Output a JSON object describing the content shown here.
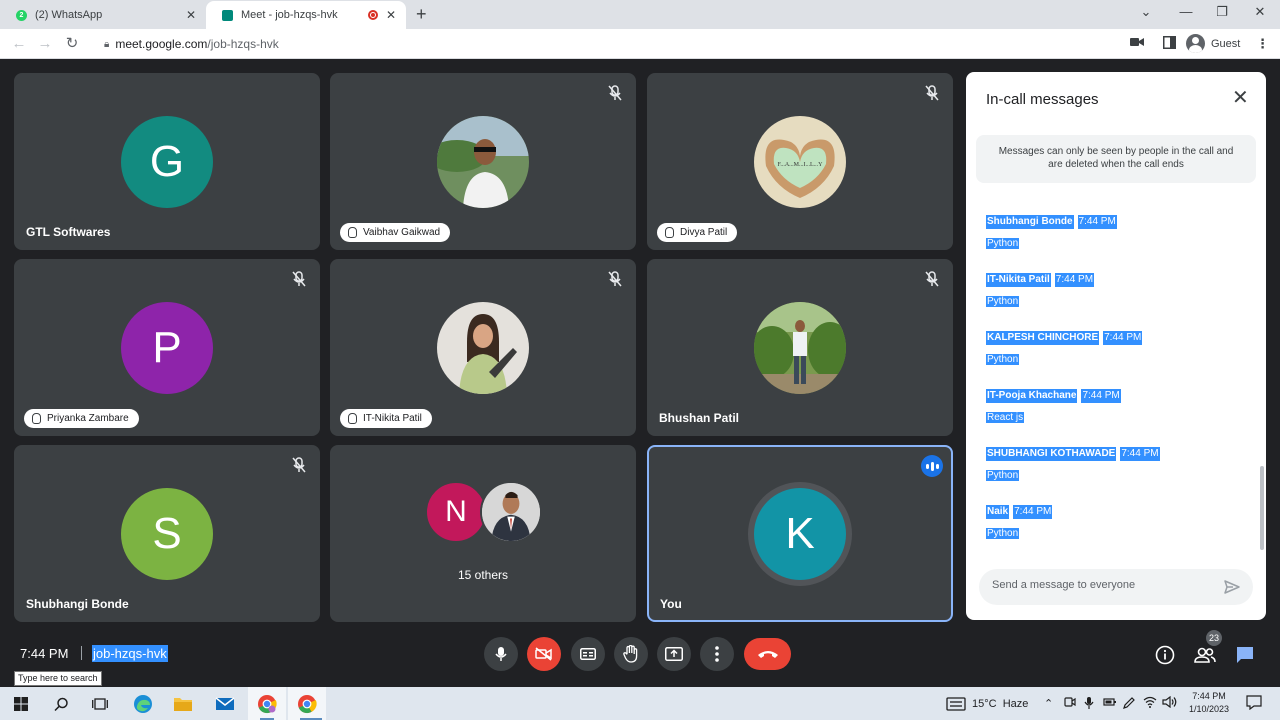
{
  "browser": {
    "tabs": [
      {
        "title": "(2) WhatsApp",
        "badge": "2"
      },
      {
        "title": "Meet - job-hzqs-hvk"
      }
    ],
    "url_host": "meet.google.com",
    "url_path": "/job-hzqs-hvk",
    "profile": "Guest"
  },
  "tiles": [
    {
      "name": "GTL Softwares",
      "letter": "G",
      "color": "#128b80"
    },
    {
      "name": "Vaibhav Gaikwad"
    },
    {
      "name": "Divya Patil"
    },
    {
      "name": "Priyanka Zambare",
      "letter": "P",
      "color": "#8e24aa"
    },
    {
      "name": "IT-Nikita Patil"
    },
    {
      "name": "Bhushan Patil"
    },
    {
      "name": "Shubhangi Bonde",
      "letter": "S",
      "color": "#7cb342"
    },
    {
      "name": "15 others",
      "letter": "N",
      "color": "#c2185b"
    },
    {
      "name": "You",
      "letter": "K",
      "color": "#1294a6"
    }
  ],
  "photo_text": {
    "family": "F...A...M...I...L...Y"
  },
  "chat": {
    "title": "In-call messages",
    "note": "Messages can only be seen by people in the call and are deleted when the call ends",
    "messages": [
      {
        "sender": "Shubhangi Bonde",
        "time": "7:44 PM",
        "text": "Python"
      },
      {
        "sender": "IT-Nikita Patil",
        "time": "7:44 PM",
        "text": "Python"
      },
      {
        "sender": "KALPESH CHINCHORE",
        "time": "7:44 PM",
        "text": "Python"
      },
      {
        "sender": "IT-Pooja Khachane",
        "time": "7:44 PM",
        "text": "React js"
      },
      {
        "sender": "SHUBHANGI KOTHAWADE",
        "time": "7:44 PM",
        "text": "Python"
      },
      {
        "sender": "Naik",
        "time": "7:44 PM",
        "text": "Python"
      }
    ],
    "placeholder": "Send a message to everyone"
  },
  "controls": {
    "time": "7:44 PM",
    "meeting_code": "job-hzqs-hvk",
    "people_count": "23"
  },
  "taskbar": {
    "search_tooltip": "Type here to search",
    "weather": "15°C  Haze",
    "time": "7:44 PM",
    "date": "1/10/2023"
  }
}
